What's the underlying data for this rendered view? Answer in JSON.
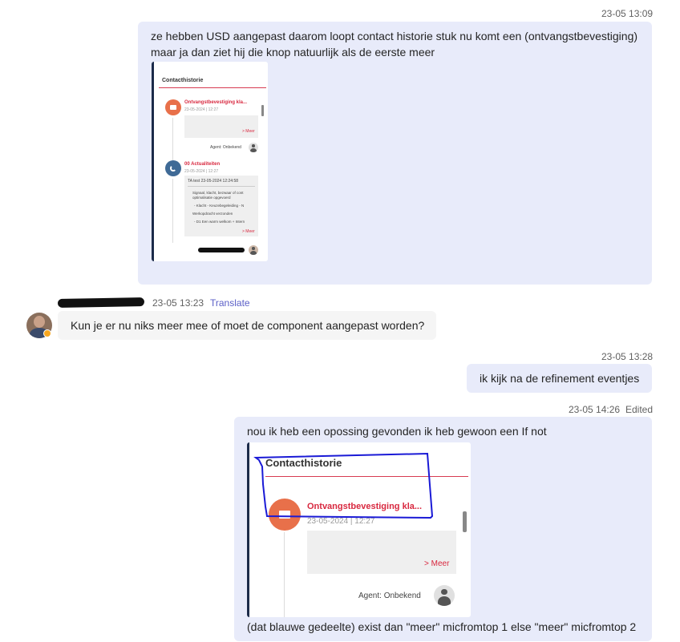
{
  "messages": [
    {
      "timestamp": "23-05 13:09",
      "text": "ze hebben USD aangepast daarom loopt contact historie stuk nu komt een (ontvangstbevestiging) maar ja dan ziet hij die knop natuurlijk als de eerste meer",
      "screenshot": {
        "title": "Contacthistorie",
        "item1_title": "Ontvangstbevestiging kla...",
        "item1_date": "23-05-2024 | 12:27",
        "item1_more": "> Meer",
        "agent": "Agent: Onbekend",
        "item2_title": "00 Actualiteiten",
        "item2_date": "23-05-2024 | 12:27",
        "item2_header": "TA test 23-05-2024 12:24:58",
        "item2_line1": "Signaal, klacht, bezwaar of cont optimalisatie opgevoerd",
        "item2_line2": "- Klacht - Keuzebegeleiding - N",
        "item2_line3": "Werkopdracht verzonden",
        "item2_line4": "- D1 Een warm welkom + Intern",
        "item2_more": "> Meer"
      }
    },
    {
      "timestamp": "23-05 13:23",
      "translate": "Translate",
      "text": "Kun je er nu niks meer mee of moet de component aangepast worden?"
    },
    {
      "timestamp": "23-05 13:28",
      "text": "ik kijk na de refinement eventjes"
    },
    {
      "timestamp": "23-05 14:26",
      "edited": "Edited",
      "text": "nou ik heb een opossing gevonden ik heb gewoon een If not",
      "screenshot": {
        "title": "Contacthistorie",
        "item1_title": "Ontvangstbevestiging kla...",
        "item1_date": "23-05-2024 | 12:27",
        "item1_more": "> Meer",
        "agent": "Agent: Onbekend"
      },
      "caption": "(dat blauwe gedeelte) exist dan \"meer\" micfromtop 1 else \"meer\" micfromtop 2"
    }
  ],
  "colors": {
    "own_bubble": "#e8ebfa",
    "other_bubble": "#f5f5f5",
    "accent_red": "#d8283f",
    "icon_orange": "#e8704a",
    "icon_blue": "#3f6a96",
    "annotation_blue": "#1a1ad6",
    "translate_link": "#5b5fc7"
  },
  "icons": [
    "mail-icon",
    "phone-icon",
    "user-avatar-icon",
    "presence-away-icon"
  ]
}
